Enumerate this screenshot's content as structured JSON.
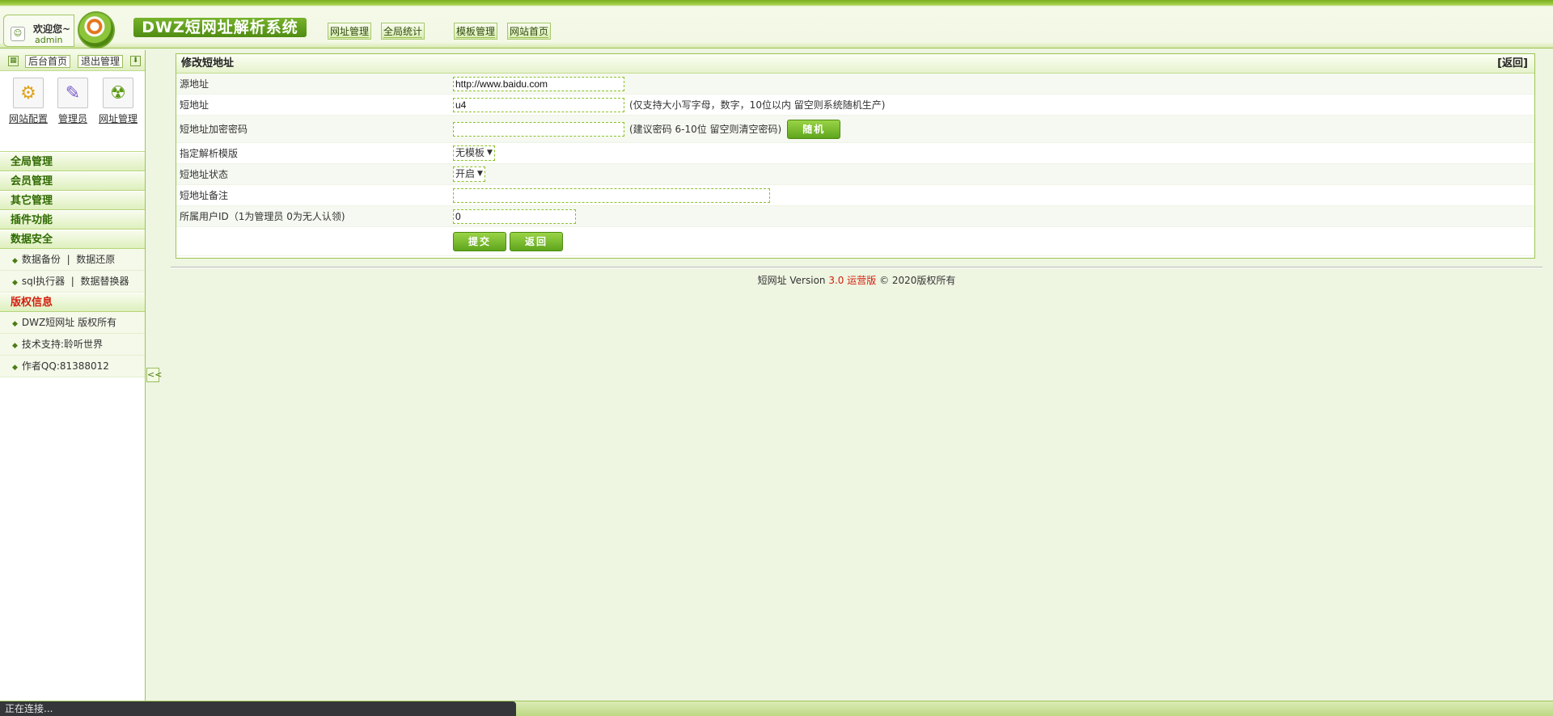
{
  "header": {
    "welcome": "欢迎您~",
    "username": "admin",
    "logo_title": "DWZ短网址解析系统",
    "nav": [
      "网址管理",
      "全局统计",
      "模板管理",
      "网站首页"
    ]
  },
  "sidebar": {
    "toolbar": {
      "home": "后台首页",
      "logout": "退出管理"
    },
    "quick": [
      {
        "label": "网站配置",
        "icon": "gears-icon"
      },
      {
        "label": "管理员",
        "icon": "admin-icon"
      },
      {
        "label": "网址管理",
        "icon": "radiation-icon"
      }
    ],
    "sections": [
      "全局管理",
      "会员管理",
      "其它管理",
      "插件功能"
    ],
    "data_security": {
      "title": "数据安全",
      "items": [
        [
          "数据备份",
          "数据还原"
        ],
        [
          "sql执行器",
          "数据替换器"
        ]
      ]
    },
    "copyright": {
      "title": "版权信息",
      "items": [
        "DWZ短网址 版权所有",
        "技术支持:聆听世界",
        "作者QQ:81388012"
      ]
    },
    "collapse_label": "<<"
  },
  "form": {
    "title": "修改短地址",
    "back": "[返回]",
    "rows": {
      "source": {
        "label": "源地址",
        "value": "http://www.baidu.com"
      },
      "short": {
        "label": "短地址",
        "value": "u4",
        "hint": "(仅支持大小写字母，数字，10位以内 留空则系统随机生产)"
      },
      "password": {
        "label": "短地址加密密码",
        "value": "",
        "hint": "(建议密码 6-10位 留空则清空密码)",
        "random_btn": "随机"
      },
      "template": {
        "label": "指定解析模版",
        "selected": "无模板"
      },
      "status": {
        "label": "短地址状态",
        "selected": "开启"
      },
      "note": {
        "label": "短地址备注",
        "value": ""
      },
      "owner": {
        "label": "所属用户ID（1为管理员 0为无人认领)",
        "value": "0"
      }
    },
    "submit": "提交",
    "return": "返回"
  },
  "footer": {
    "prefix": "短网址 Version ",
    "version": "3.0 运营版",
    "suffix": " © 2020版权所有"
  },
  "status_bar": "正在连接..."
}
